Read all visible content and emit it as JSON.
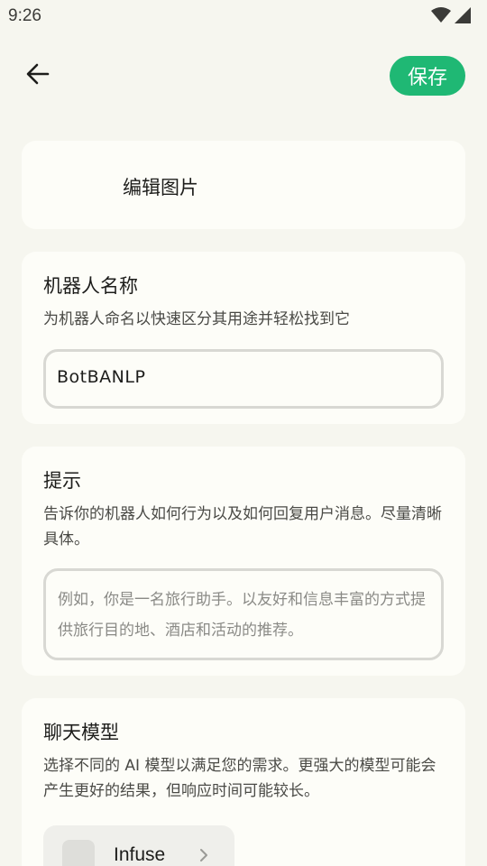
{
  "status_bar": {
    "time": "9:26",
    "icons": [
      "wifi-icon",
      "signal-icon"
    ]
  },
  "toolbar": {
    "back_icon": "arrow-left-icon",
    "save_label": "保存",
    "accent_color": "#1fb874"
  },
  "image_card": {
    "label": "编辑图片"
  },
  "name_card": {
    "title": "机器人名称",
    "description": "为机器人命名以快速区分其用途并轻松找到它",
    "value": "BotBANLP"
  },
  "prompt_card": {
    "title": "提示",
    "description": "告诉你的机器人如何行为以及如何回复用户消息。尽量清晰具体。",
    "placeholder": "例如，你是一名旅行助手。以友好和信息丰富的方式提供旅行目的地、酒店和活动的推荐。"
  },
  "model_card": {
    "title": "聊天模型",
    "description": "选择不同的 AI 模型以满足您的需求。更强大的模型可能会产生更好的结果，但响应时间可能较长。",
    "selected_model": "Infuse",
    "chevron_icon": "chevron-right-icon"
  }
}
